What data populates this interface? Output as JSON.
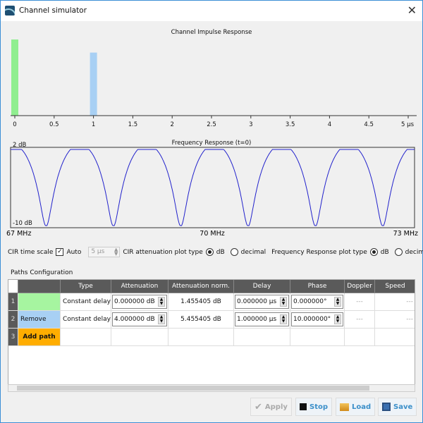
{
  "window": {
    "title": "Channel simulator"
  },
  "chart_data": [
    {
      "type": "bar",
      "title": "Channel Impulse Response",
      "xlabel": "",
      "ylabel": "",
      "x_ticks": [
        "0",
        "0.5",
        "1",
        "1.5",
        "2",
        "2.5",
        "3",
        "3.5",
        "4",
        "4.5",
        "5 µs"
      ],
      "xlim": [
        0,
        5
      ],
      "bars": [
        {
          "x": 0,
          "attenuation_db": 0,
          "color": "#90ee90"
        },
        {
          "x": 1,
          "attenuation_db": 4,
          "color": "#a8d0f4"
        }
      ]
    },
    {
      "type": "line",
      "title": "Frequency Response (t=0)",
      "y_labels": [
        "2 dB",
        "-10 dB"
      ],
      "ylim": [
        -10,
        2
      ],
      "x_ticks": [
        "67 MHz",
        "70 MHz",
        "73 MHz"
      ],
      "xlim": [
        67,
        73
      ],
      "series": [
        {
          "name": "response",
          "color": "#2222cc",
          "paths": [
            {
              "atten_db": 0,
              "delay_us": 0,
              "phase_deg": 0
            },
            {
              "atten_db": 4,
              "delay_us": 1,
              "phase_deg": 10
            }
          ],
          "norm_db": 1.455405
        }
      ]
    }
  ],
  "options": {
    "cir_time_scale": "CIR time scale",
    "auto": "Auto",
    "auto_checked": true,
    "time_value": "5 µs",
    "cir_att_type": "CIR attenuation plot type",
    "db": "dB",
    "decimal": "decimal",
    "freq_type": "Frequency Response plot type"
  },
  "paths": {
    "label": "Paths Configuration",
    "headers": [
      "",
      "Type",
      "Attenuation",
      "Attenuation norm.",
      "Delay",
      "Phase",
      "Doppler",
      "Speed"
    ],
    "rows": [
      {
        "num": "1",
        "action": "",
        "color": "#a6f5a0",
        "type": "Constant delay",
        "attenuation": "0.000000 dB",
        "norm": "1.455405 dB",
        "delay": "0.000000 µs",
        "phase": "0.000000°",
        "doppler": "---",
        "speed": "---"
      },
      {
        "num": "2",
        "action": "Remove",
        "color": "#a8d0f4",
        "type": "Constant delay",
        "attenuation": "4.000000 dB",
        "norm": "5.455405 dB",
        "delay": "1.000000 µs",
        "phase": "10.000000°",
        "doppler": "---",
        "speed": "---"
      },
      {
        "num": "3",
        "action": "Add path",
        "color": "#ffad00"
      }
    ]
  },
  "buttons": {
    "apply": "Apply",
    "stop": "Stop",
    "load": "Load",
    "save": "Save"
  }
}
